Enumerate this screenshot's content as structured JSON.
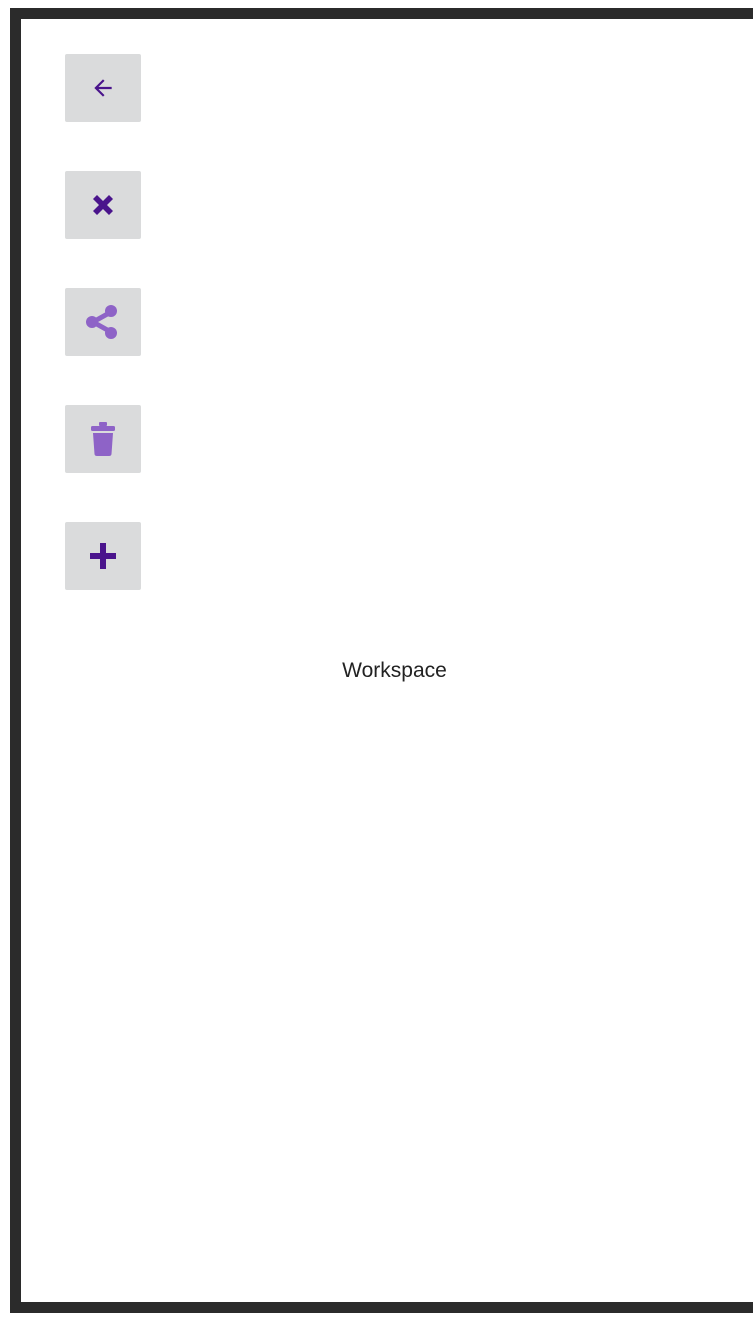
{
  "toolbar": {
    "buttons": [
      {
        "name": "back-button",
        "icon": "arrow-left-icon",
        "color": "#4a148c"
      },
      {
        "name": "close-button",
        "icon": "close-icon",
        "color": "#4a148c"
      },
      {
        "name": "share-button",
        "icon": "share-icon",
        "color": "#8e63c7"
      },
      {
        "name": "delete-button",
        "icon": "trash-icon",
        "color": "#8e63c7"
      },
      {
        "name": "add-button",
        "icon": "plus-icon",
        "color": "#4a148c"
      }
    ]
  },
  "main": {
    "label": "Workspace"
  },
  "colors": {
    "frame": "#2b2b2b",
    "button_bg": "#dadbdc",
    "icon_primary": "#4a148c",
    "icon_disabled": "#8e63c7"
  }
}
